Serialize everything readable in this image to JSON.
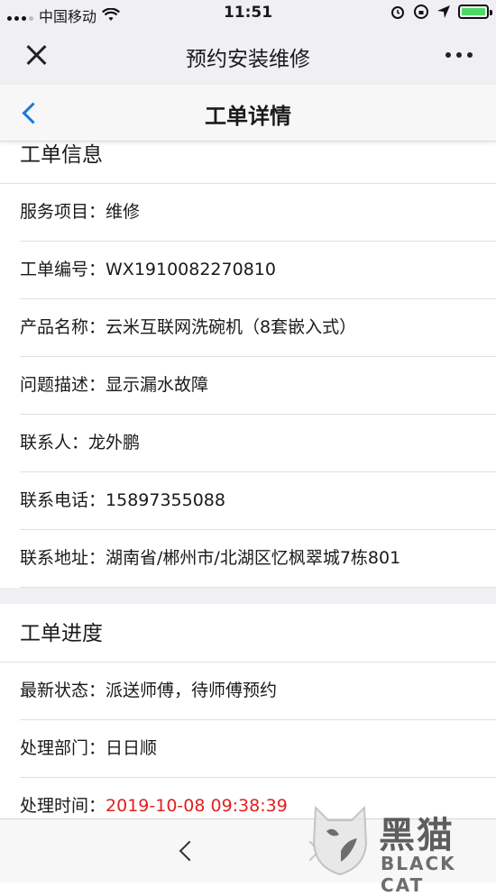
{
  "status_bar": {
    "carrier": "中国移动",
    "time": "11:51"
  },
  "wechat_bar": {
    "title": "预约安装维修"
  },
  "page_header": {
    "title": "工单详情"
  },
  "work_order_info": {
    "title": "工单信息",
    "rows": [
      {
        "label": "服务项目：",
        "value": "维修"
      },
      {
        "label": "工单编号：",
        "value": "WX1910082270810"
      },
      {
        "label": "产品名称：",
        "value": "云米互联网洗碗机（8套嵌入式）"
      },
      {
        "label": "问题描述：",
        "value": "显示漏水故障"
      },
      {
        "label": "联系人：",
        "value": "龙外鹏"
      },
      {
        "label": "联系电话：",
        "value": "15897355088"
      },
      {
        "label": "联系地址：",
        "value": "湖南省/郴州市/北湖区忆枫翠城7栋801"
      }
    ]
  },
  "work_order_progress": {
    "title": "工单进度",
    "rows": [
      {
        "label": "最新状态：",
        "value": "派送师傅，待师傅预约"
      },
      {
        "label": "处理部门：",
        "value": "日日顺"
      },
      {
        "label": "处理时间：",
        "value": "2019-10-08 09:38:39"
      }
    ]
  },
  "watermark": {
    "brand_cn": "黑猫",
    "brand_en": "BLACK CAT"
  },
  "colors": {
    "accent": "#1a7ad9",
    "time_highlight": "#e02020",
    "battery": "#4cd964"
  }
}
